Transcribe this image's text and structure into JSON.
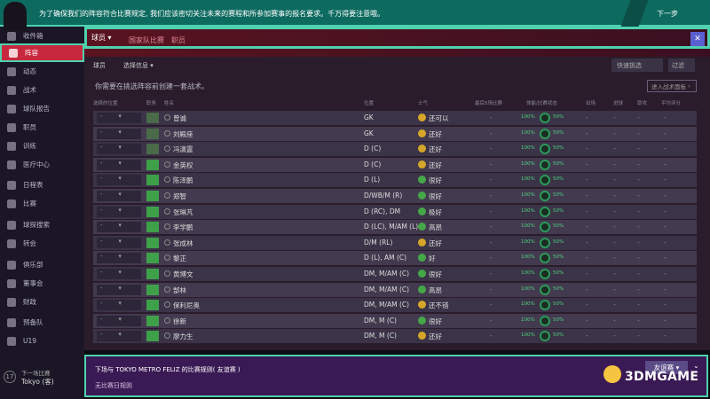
{
  "banner": {
    "message": "为了确保我们的阵容符合比赛规定, 我们应该密切关注未来的赛程和所参加赛事的报名要求。千万得要注意哦。",
    "next": "下一步"
  },
  "sidebar": {
    "items": [
      {
        "label": "收件箱"
      },
      {
        "label": "阵容"
      },
      {
        "label": "动态"
      },
      {
        "label": "战术"
      },
      {
        "label": "球队报告"
      },
      {
        "label": "职员"
      },
      {
        "label": "训练"
      },
      {
        "label": "医疗中心"
      },
      {
        "label": "日程表"
      },
      {
        "label": "比赛"
      },
      {
        "label": "球探搜索"
      },
      {
        "label": "转会"
      },
      {
        "label": "俱乐部"
      },
      {
        "label": "董事会"
      },
      {
        "label": "财政"
      },
      {
        "label": "预备队"
      },
      {
        "label": "U19"
      }
    ],
    "next_match": {
      "number": "17",
      "label": "下一场比赛",
      "team": "Tokyo (客)"
    }
  },
  "tabs": {
    "players": "球员",
    "national": "国家队比赛",
    "staff": "职员"
  },
  "subbar": {
    "players": "球员",
    "select": "选择信息"
  },
  "toolbar": {
    "quick_pick": "快速挑选",
    "filter": "过滤"
  },
  "hint": "你需要在挑选阵容前创建一套战术。",
  "add_tactic": "进入战术面板",
  "headers": [
    "选择的位置",
    "职务",
    "姓名",
    "位置",
    "士气",
    "最后5场比赛",
    "体能/比赛状态",
    "出场",
    "进球",
    "助攻",
    "平均评分"
  ],
  "players": [
    {
      "name": "曾诚",
      "pos": "GK",
      "mood": "还可以"
    },
    {
      "name": "刘殿座",
      "pos": "GK",
      "mood": "还好"
    },
    {
      "name": "冯潇霆",
      "pos": "D (C)",
      "mood": "还好"
    },
    {
      "name": "金英权",
      "pos": "D (C)",
      "mood": "还好"
    },
    {
      "name": "陈泽鹏",
      "pos": "D (L)",
      "mood": "很好"
    },
    {
      "name": "郑智",
      "pos": "D/WB/M (R)",
      "mood": "很好"
    },
    {
      "name": "张琳芃",
      "pos": "D (RC), DM",
      "mood": "极好"
    },
    {
      "name": "李学鹏",
      "pos": "D (LC), M/AM (L)",
      "mood": "高昂"
    },
    {
      "name": "张成林",
      "pos": "D/M (RL)",
      "mood": "还好"
    },
    {
      "name": "黎正",
      "pos": "D (L), AM (C)",
      "mood": "好"
    },
    {
      "name": "黄博文",
      "pos": "DM, M/AM (C)",
      "mood": "很好"
    },
    {
      "name": "郜林",
      "pos": "DM, M/AM (C)",
      "mood": "高昂"
    },
    {
      "name": "保利尼奥",
      "pos": "DM, M/AM (C)",
      "mood": "还不错"
    },
    {
      "name": "徐新",
      "pos": "DM, M (C)",
      "mood": "很好"
    },
    {
      "name": "廖力生",
      "pos": "DM, M (C)",
      "mood": "还好"
    }
  ],
  "condition": "100%",
  "sharpness": "50%",
  "dash": "-",
  "bottom": {
    "rule_title": "下场与 TOKYO METRO FELIZ 的比赛规则( 友谊赛 )",
    "rule_text": "无比赛日规则",
    "competition": "友谊赛"
  },
  "watermark": "3DMGAME"
}
